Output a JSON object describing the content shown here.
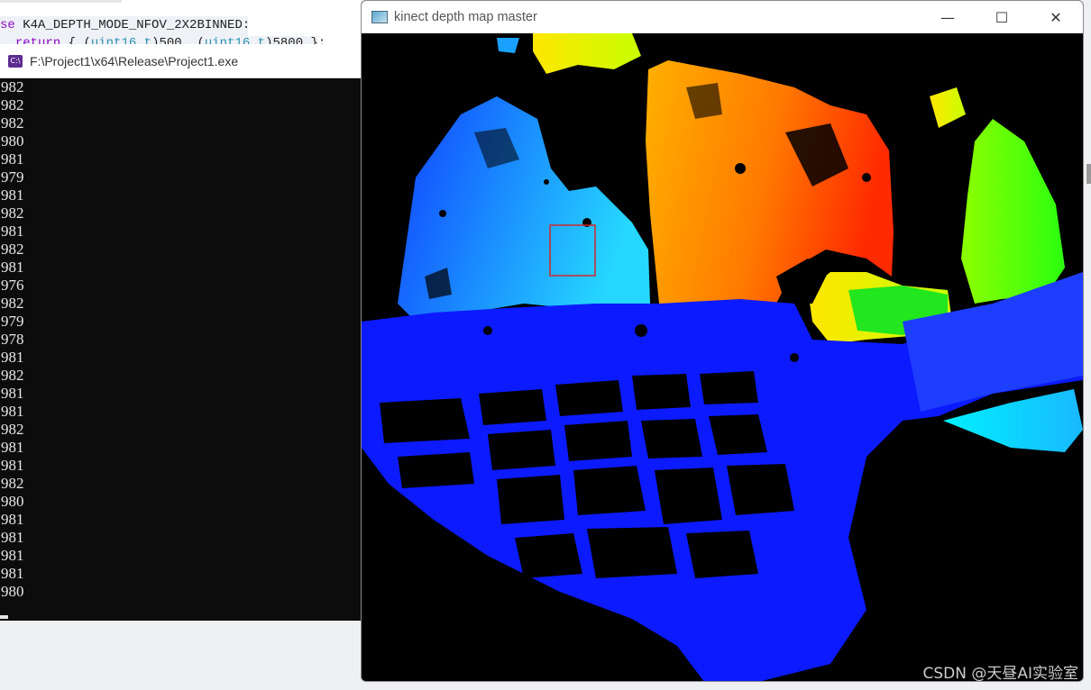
{
  "editor": {
    "line1": "se K4A_DEPTH_MODE_NFOV_2X2BINNED:",
    "line2": "  return { (uint16_t)500, (uint16_t)5800 };"
  },
  "console": {
    "title": "F:\\Project1\\x64\\Release\\Project1.exe",
    "icon_label": "C:\\",
    "lines": [
      "982",
      "982",
      "982",
      "980",
      "981",
      "979",
      "981",
      "982",
      "981",
      "982",
      "981",
      "976",
      "982",
      "979",
      "978",
      "981",
      "982",
      "981",
      "981",
      "982",
      "981",
      "981",
      "982",
      "980",
      "981",
      "981",
      "981",
      "981",
      "980"
    ]
  },
  "depth_window": {
    "title": "kinect depth map master",
    "minimize": "—",
    "maximize": "☐",
    "close": "✕",
    "roi_color": "#d1262b"
  },
  "watermark": "CSDN @天昼AI实验室"
}
